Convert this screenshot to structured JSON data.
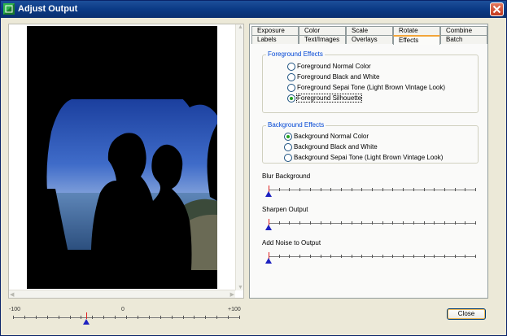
{
  "window": {
    "title": "Adjust Output"
  },
  "preview": {
    "zoom_min_label": "-100",
    "zoom_mid_label": "0",
    "zoom_max_label": "+100",
    "zoom_value": -35
  },
  "tabs": {
    "row1": [
      "Exposure",
      "Color",
      "Scale",
      "Rotate",
      "Combine"
    ],
    "row2": [
      "Labels",
      "Text/Images",
      "Overlays",
      "Effects",
      "Batch"
    ],
    "active": "Effects"
  },
  "foreground_effects": {
    "legend": "Foreground Effects",
    "options": [
      {
        "label": "Foreground  Normal Color",
        "checked": false
      },
      {
        "label": "Foreground  Black and White",
        "checked": false
      },
      {
        "label": "Foreground  Sepai Tone (Light Brown Vintage Look)",
        "checked": false
      },
      {
        "label": "Foreground  Silhouette",
        "checked": true
      }
    ]
  },
  "background_effects": {
    "legend": "Background Effects",
    "options": [
      {
        "label": "Background  Normal Color",
        "checked": true
      },
      {
        "label": "Background  Black and White",
        "checked": false
      },
      {
        "label": "Background  Sepai Tone (Light Brown Vintage Look)",
        "checked": false
      }
    ]
  },
  "sliders": [
    {
      "label": "Blur Background",
      "value": 0
    },
    {
      "label": "Sharpen Output",
      "value": 0
    },
    {
      "label": "Add Noise to Output",
      "value": 0
    }
  ],
  "buttons": {
    "close_label": "Close"
  },
  "colors": {
    "titlebar": "#0b3a85",
    "group_legend": "#0046d5",
    "slider_thumb": "#1e22c0",
    "radio_checked": "#21a121",
    "active_tab_accent": "#f2a53a"
  }
}
